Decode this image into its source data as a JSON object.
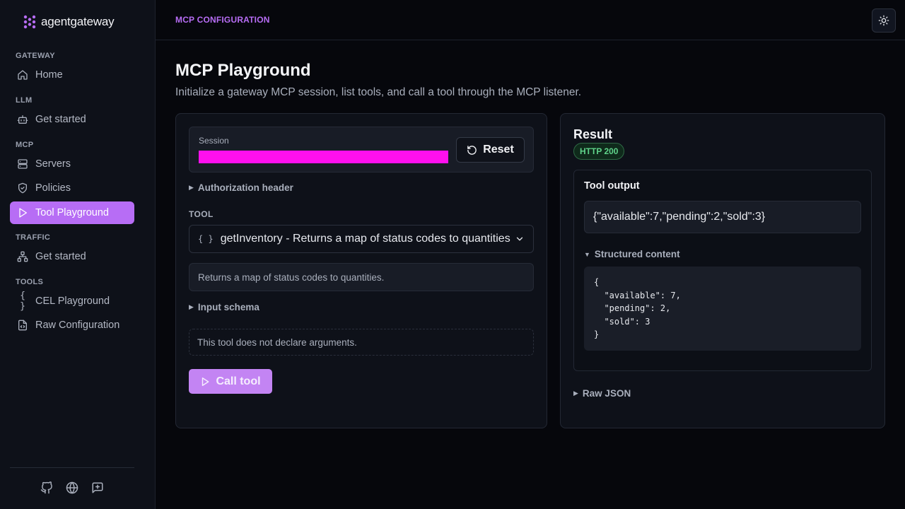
{
  "brand": {
    "name": "agentgateway",
    "accent": "#b76df5"
  },
  "sidebar": {
    "sections": [
      {
        "label": "GATEWAY",
        "items": [
          {
            "label": "Home",
            "icon": "home-icon"
          }
        ]
      },
      {
        "label": "LLM",
        "items": [
          {
            "label": "Get started",
            "icon": "bot-icon"
          }
        ]
      },
      {
        "label": "MCP",
        "items": [
          {
            "label": "Servers",
            "icon": "server-icon"
          },
          {
            "label": "Policies",
            "icon": "shield-icon"
          },
          {
            "label": "Tool Playground",
            "icon": "play-icon",
            "active": true
          }
        ]
      },
      {
        "label": "TRAFFIC",
        "items": [
          {
            "label": "Get started",
            "icon": "network-icon"
          }
        ]
      },
      {
        "label": "TOOLS",
        "items": [
          {
            "label": "CEL Playground",
            "icon": "braces-icon"
          },
          {
            "label": "Raw Configuration",
            "icon": "file-code-icon"
          }
        ]
      }
    ],
    "footer_icons": [
      "github-icon",
      "globe-icon",
      "feedback-icon"
    ]
  },
  "header": {
    "breadcrumb": "MCP CONFIGURATION",
    "theme_icon": "sun-icon"
  },
  "page": {
    "title": "MCP Playground",
    "subtitle": "Initialize a gateway MCP session, list tools, and call a tool through the MCP listener."
  },
  "left_panel": {
    "session_label": "Session",
    "session_bar_color": "#ff10ee",
    "reset_label": "Reset",
    "auth_header_label": "Authorization header",
    "tool_label": "TOOL",
    "tool_select_value": "getInventory - Returns a map of status codes to quantities",
    "tool_description": "Returns a map of status codes to quantities.",
    "input_schema_label": "Input schema",
    "no_args_text": "This tool does not declare arguments.",
    "call_label": "Call tool"
  },
  "result_panel": {
    "title": "Result",
    "status_badge": "HTTP 200",
    "tool_output_label": "Tool output",
    "tool_output_value": "{\"available\":7,\"pending\":2,\"sold\":3}",
    "structured_label": "Structured content",
    "structured_json": "{\n  \"available\": 7,\n  \"pending\": 2,\n  \"sold\": 3\n}",
    "raw_json_label": "Raw JSON"
  }
}
